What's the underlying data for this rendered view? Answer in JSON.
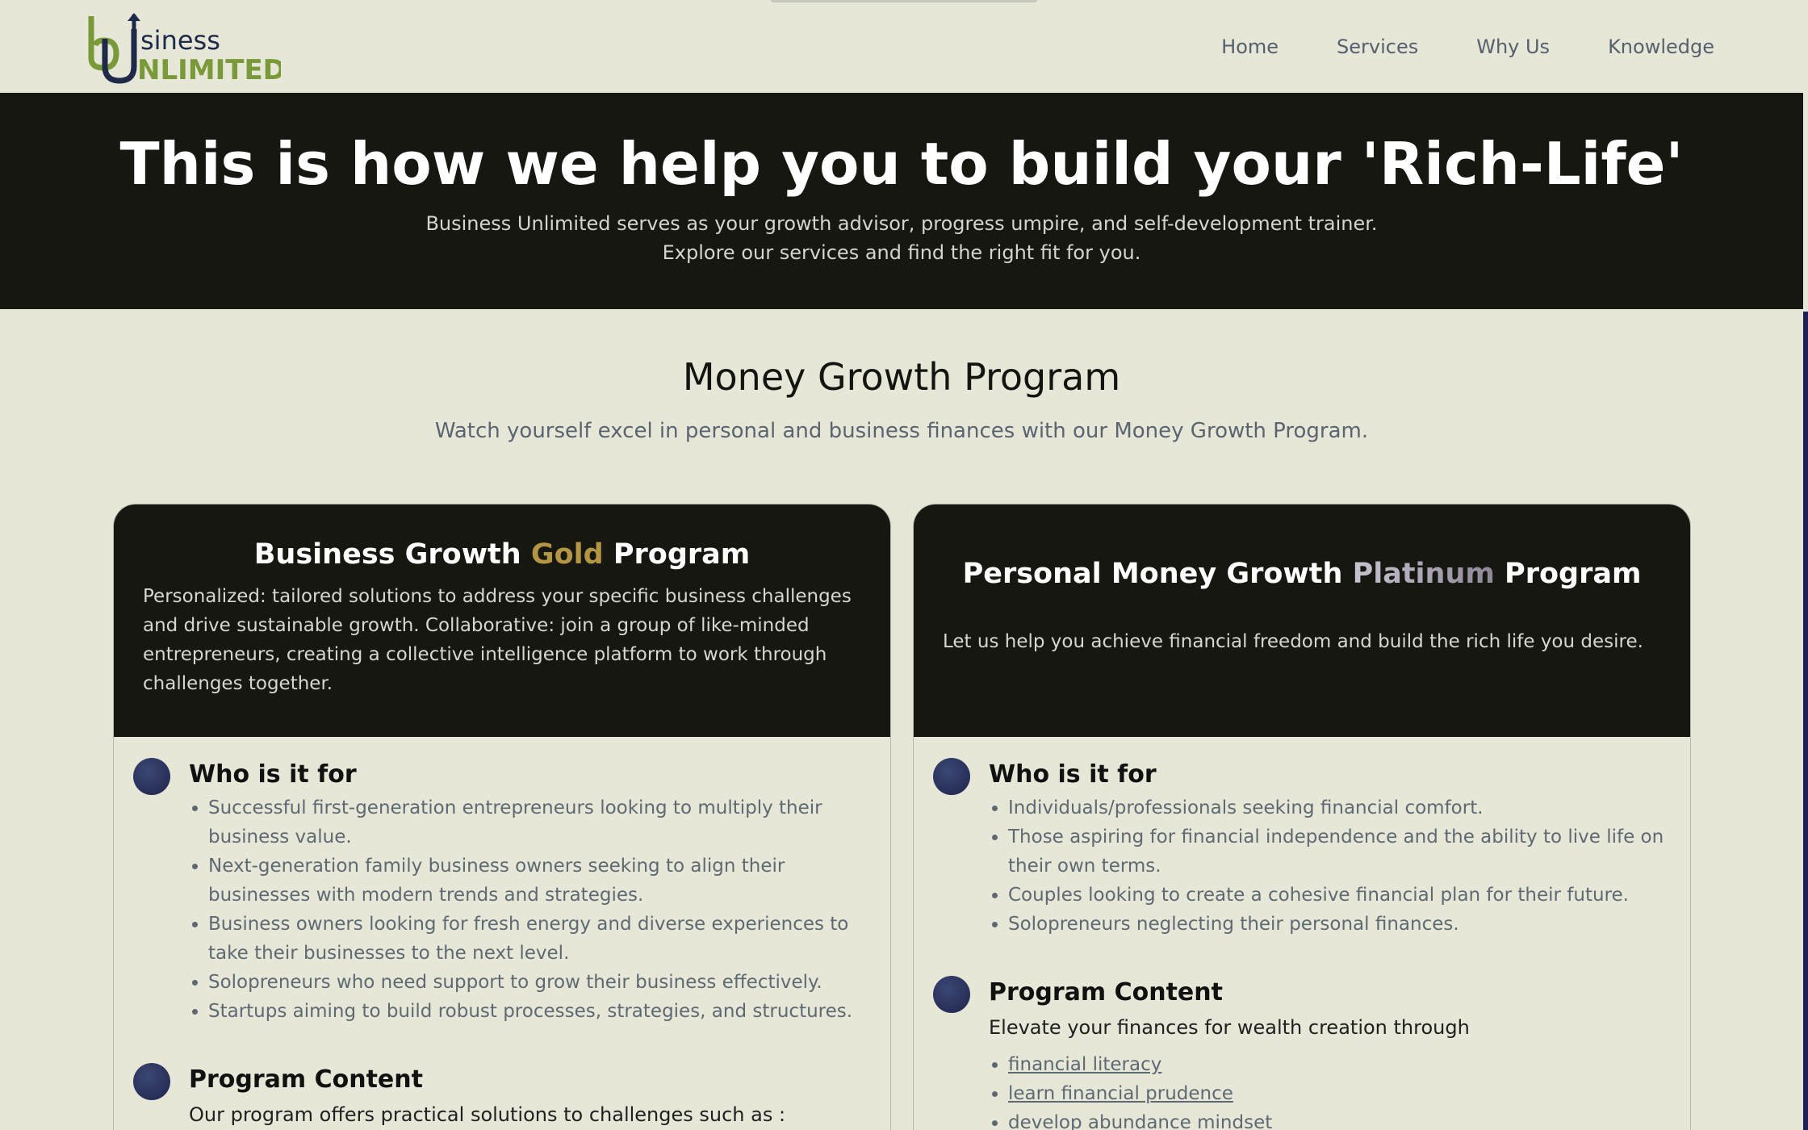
{
  "header": {
    "logo_text": {
      "top": "siness",
      "bottom": "NLIMITED",
      "mark": "bu"
    },
    "nav": [
      "Home",
      "Services",
      "Why Us",
      "Knowledge"
    ]
  },
  "hero": {
    "title": "This is how we help you to build your 'Rich-Life'",
    "subtitle_line1": "Business Unlimited serves as your growth advisor, progress umpire, and self-development trainer.",
    "subtitle_line2": "Explore our services and find the right fit for you."
  },
  "section": {
    "title": "Money Growth Program",
    "subtitle": "Watch yourself excel in personal and business finances with our Money Growth Program."
  },
  "cards": [
    {
      "title_pre": "Business Growth ",
      "title_highlight": "Gold",
      "title_post": " Program",
      "description": "Personalized: tailored solutions to address your specific business challenges and drive sustainable growth. Collaborative: join a group of like-minded entrepreneurs, creating a collective intelligence platform to work through challenges together.",
      "who_title": "Who is it for",
      "who_items": [
        "Successful first-generation entrepreneurs looking to multiply their business value.",
        "Next-generation family business owners seeking to align their businesses with modern trends and strategies.",
        "Business owners looking for fresh energy and diverse experiences to take their businesses to the next level.",
        "Solopreneurs who need support to grow their business effectively.",
        "Startups aiming to build robust processes, strategies, and structures."
      ],
      "content_title": "Program Content",
      "content_intro": "Our program offers practical solutions to challenges such as :"
    },
    {
      "title_pre": "Personal Money Growth ",
      "title_highlight": "Platinum",
      "title_post": " Program",
      "description": "Let us help you achieve financial freedom and build the rich life you desire.",
      "who_title": "Who is it for",
      "who_items": [
        "Individuals/professionals seeking financial comfort.",
        "Those aspiring for financial independence and the ability to live life on their own terms.",
        "Couples looking to create a cohesive financial plan for their future.",
        "Solopreneurs neglecting their personal finances."
      ],
      "content_title": "Program Content",
      "content_intro": "Elevate your finances for wealth creation through",
      "content_links": [
        "financial literacy",
        "learn financial prudence",
        "develop abundance mindset"
      ]
    }
  ],
  "colors": {
    "background": "#e6e7d7",
    "dark": "#161711",
    "gold": "#b49543",
    "logo_green": "#7a9a3a",
    "logo_navy": "#1f2a4a",
    "scroll_thumb": "#1d1f55"
  }
}
